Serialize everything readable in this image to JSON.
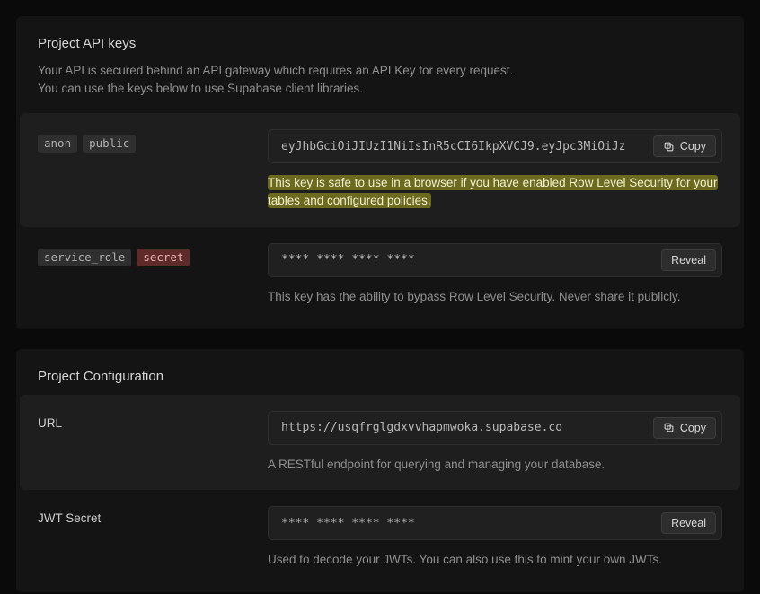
{
  "api_keys": {
    "title": "Project API keys",
    "subtitle": "Your API is secured behind an API gateway which requires an API Key for every request.\nYou can use the keys below to use Supabase client libraries.",
    "anon": {
      "tag1": "anon",
      "tag2": "public",
      "value": "eyJhbGciOiJIUzI1NiIsInR5cCI6IkpXVCJ9.eyJpc3MiOiJz",
      "copy_label": "Copy",
      "desc": "This key is safe to use in a browser if you have enabled Row Level Security for your tables and configured policies."
    },
    "service": {
      "tag1": "service_role",
      "tag2": "secret",
      "value": "**** **** **** ****",
      "reveal_label": "Reveal",
      "desc": "This key has the ability to bypass Row Level Security. Never share it publicly."
    }
  },
  "config": {
    "title": "Project Configuration",
    "url": {
      "label": "URL",
      "value": "https://usqfrglgdxvvhapmwoka.supabase.co",
      "copy_label": "Copy",
      "desc": "A RESTful endpoint for querying and managing your database."
    },
    "jwt": {
      "label": "JWT Secret",
      "value": "**** **** **** ****",
      "reveal_label": "Reveal",
      "desc": "Used to decode your JWTs. You can also use this to mint your own JWTs."
    }
  }
}
